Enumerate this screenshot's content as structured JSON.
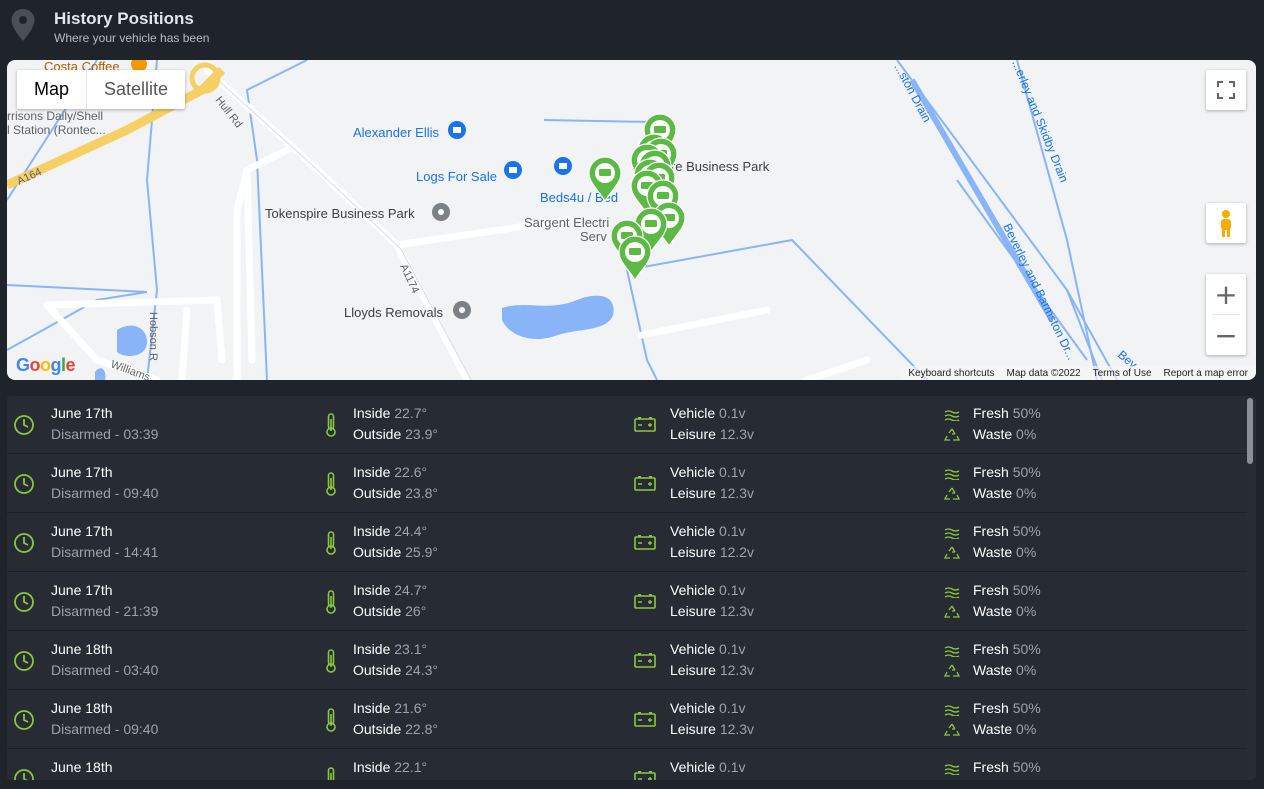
{
  "header": {
    "title": "History Positions",
    "subtitle": "Where your vehicle has been"
  },
  "map": {
    "map_type": {
      "map": "Map",
      "satellite": "Satellite"
    },
    "labels": {
      "costa": "Costa Coffee",
      "harrisons": "rrisons Daily/Shell",
      "station": "l Station (Rontec...",
      "a164": "A164",
      "hull_rd": "Hull Rd",
      "alexander": "Alexander Ellis",
      "logs": "Logs For Sale",
      "beds": "Beds4u / Bed",
      "tokenspire_park": "Tokenspire Business Park",
      "tokenspire_park_right": "T...spire Business Park",
      "sargent": "Sargent Electri",
      "serv": "Serv",
      "a1174": "A1174",
      "lloyds": "Lloyds Removals",
      "hobson": "Hobson R",
      "williams": "Williams",
      "drain_left": "...ston Drain",
      "skidby": "...erley and Skidby Drain",
      "barmston": "Beverley and Barmston Dr...",
      "bev": "Bev"
    },
    "zoom_in": "+",
    "zoom_out": "−",
    "google": "Google",
    "attribution": {
      "shortcuts": "Keyboard shortcuts",
      "data": "Map data ©2022",
      "terms": "Terms of Use",
      "report": "Report a map error"
    }
  },
  "rows": [
    {
      "date": "June 17th",
      "status": "Disarmed - 03:39",
      "inside_label": "Inside",
      "inside": "22.7°",
      "outside_label": "Outside",
      "outside": "23.9°",
      "vehicle_label": "Vehicle",
      "vehicle": "0.1v",
      "leisure_label": "Leisure",
      "leisure": "12.3v",
      "fresh_label": "Fresh",
      "fresh": "50%",
      "waste_label": "Waste",
      "waste": "0%"
    },
    {
      "date": "June 17th",
      "status": "Disarmed - 09:40",
      "inside_label": "Inside",
      "inside": "22.6°",
      "outside_label": "Outside",
      "outside": "23.8°",
      "vehicle_label": "Vehicle",
      "vehicle": "0.1v",
      "leisure_label": "Leisure",
      "leisure": "12.3v",
      "fresh_label": "Fresh",
      "fresh": "50%",
      "waste_label": "Waste",
      "waste": "0%"
    },
    {
      "date": "June 17th",
      "status": "Disarmed - 14:41",
      "inside_label": "Inside",
      "inside": "24.4°",
      "outside_label": "Outside",
      "outside": "25.9°",
      "vehicle_label": "Vehicle",
      "vehicle": "0.1v",
      "leisure_label": "Leisure",
      "leisure": "12.2v",
      "fresh_label": "Fresh",
      "fresh": "50%",
      "waste_label": "Waste",
      "waste": "0%"
    },
    {
      "date": "June 17th",
      "status": "Disarmed - 21:39",
      "inside_label": "Inside",
      "inside": "24.7°",
      "outside_label": "Outside",
      "outside": "26°",
      "vehicle_label": "Vehicle",
      "vehicle": "0.1v",
      "leisure_label": "Leisure",
      "leisure": "12.3v",
      "fresh_label": "Fresh",
      "fresh": "50%",
      "waste_label": "Waste",
      "waste": "0%"
    },
    {
      "date": "June 18th",
      "status": "Disarmed - 03:40",
      "inside_label": "Inside",
      "inside": "23.1°",
      "outside_label": "Outside",
      "outside": "24.3°",
      "vehicle_label": "Vehicle",
      "vehicle": "0.1v",
      "leisure_label": "Leisure",
      "leisure": "12.3v",
      "fresh_label": "Fresh",
      "fresh": "50%",
      "waste_label": "Waste",
      "waste": "0%"
    },
    {
      "date": "June 18th",
      "status": "Disarmed - 09:40",
      "inside_label": "Inside",
      "inside": "21.6°",
      "outside_label": "Outside",
      "outside": "22.8°",
      "vehicle_label": "Vehicle",
      "vehicle": "0.1v",
      "leisure_label": "Leisure",
      "leisure": "12.3v",
      "fresh_label": "Fresh",
      "fresh": "50%",
      "waste_label": "Waste",
      "waste": "0%"
    },
    {
      "date": "June 18th",
      "status": "",
      "inside_label": "Inside",
      "inside": "22.1°",
      "outside_label": "",
      "outside": "",
      "vehicle_label": "Vehicle",
      "vehicle": "0.1v",
      "leisure_label": "",
      "leisure": "",
      "fresh_label": "Fresh",
      "fresh": "50%",
      "waste_label": "",
      "waste": ""
    }
  ],
  "colors": {
    "accent_green": "#8dc63f",
    "marker_green": "#5cb946",
    "row_bg": "#262b34",
    "page_bg": "#1f232a"
  },
  "icons": {
    "clock": "clock-icon",
    "thermometer": "thermometer-icon",
    "battery": "battery-icon",
    "water": "water-waves-icon",
    "recycle": "recycle-icon"
  }
}
